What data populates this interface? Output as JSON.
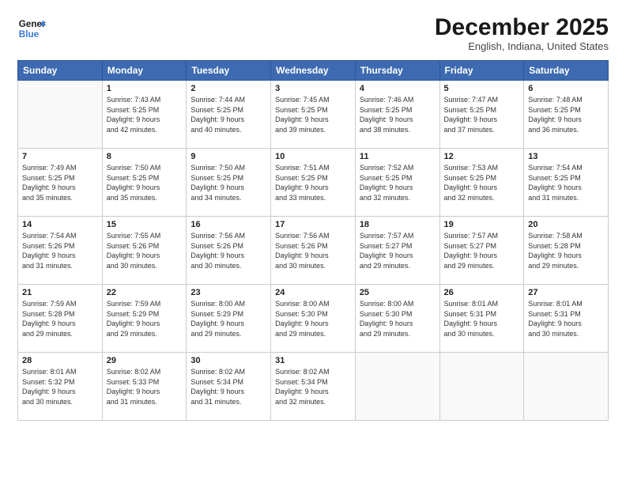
{
  "logo": {
    "line1": "General",
    "line2": "Blue"
  },
  "header": {
    "month": "December 2025",
    "location": "English, Indiana, United States"
  },
  "days_of_week": [
    "Sunday",
    "Monday",
    "Tuesday",
    "Wednesday",
    "Thursday",
    "Friday",
    "Saturday"
  ],
  "weeks": [
    [
      {
        "day": "",
        "info": ""
      },
      {
        "day": "1",
        "info": "Sunrise: 7:43 AM\nSunset: 5:25 PM\nDaylight: 9 hours\nand 42 minutes."
      },
      {
        "day": "2",
        "info": "Sunrise: 7:44 AM\nSunset: 5:25 PM\nDaylight: 9 hours\nand 40 minutes."
      },
      {
        "day": "3",
        "info": "Sunrise: 7:45 AM\nSunset: 5:25 PM\nDaylight: 9 hours\nand 39 minutes."
      },
      {
        "day": "4",
        "info": "Sunrise: 7:46 AM\nSunset: 5:25 PM\nDaylight: 9 hours\nand 38 minutes."
      },
      {
        "day": "5",
        "info": "Sunrise: 7:47 AM\nSunset: 5:25 PM\nDaylight: 9 hours\nand 37 minutes."
      },
      {
        "day": "6",
        "info": "Sunrise: 7:48 AM\nSunset: 5:25 PM\nDaylight: 9 hours\nand 36 minutes."
      }
    ],
    [
      {
        "day": "7",
        "info": "Sunrise: 7:49 AM\nSunset: 5:25 PM\nDaylight: 9 hours\nand 35 minutes."
      },
      {
        "day": "8",
        "info": "Sunrise: 7:50 AM\nSunset: 5:25 PM\nDaylight: 9 hours\nand 35 minutes."
      },
      {
        "day": "9",
        "info": "Sunrise: 7:50 AM\nSunset: 5:25 PM\nDaylight: 9 hours\nand 34 minutes."
      },
      {
        "day": "10",
        "info": "Sunrise: 7:51 AM\nSunset: 5:25 PM\nDaylight: 9 hours\nand 33 minutes."
      },
      {
        "day": "11",
        "info": "Sunrise: 7:52 AM\nSunset: 5:25 PM\nDaylight: 9 hours\nand 32 minutes."
      },
      {
        "day": "12",
        "info": "Sunrise: 7:53 AM\nSunset: 5:25 PM\nDaylight: 9 hours\nand 32 minutes."
      },
      {
        "day": "13",
        "info": "Sunrise: 7:54 AM\nSunset: 5:25 PM\nDaylight: 9 hours\nand 31 minutes."
      }
    ],
    [
      {
        "day": "14",
        "info": "Sunrise: 7:54 AM\nSunset: 5:26 PM\nDaylight: 9 hours\nand 31 minutes."
      },
      {
        "day": "15",
        "info": "Sunrise: 7:55 AM\nSunset: 5:26 PM\nDaylight: 9 hours\nand 30 minutes."
      },
      {
        "day": "16",
        "info": "Sunrise: 7:56 AM\nSunset: 5:26 PM\nDaylight: 9 hours\nand 30 minutes."
      },
      {
        "day": "17",
        "info": "Sunrise: 7:56 AM\nSunset: 5:26 PM\nDaylight: 9 hours\nand 30 minutes."
      },
      {
        "day": "18",
        "info": "Sunrise: 7:57 AM\nSunset: 5:27 PM\nDaylight: 9 hours\nand 29 minutes."
      },
      {
        "day": "19",
        "info": "Sunrise: 7:57 AM\nSunset: 5:27 PM\nDaylight: 9 hours\nand 29 minutes."
      },
      {
        "day": "20",
        "info": "Sunrise: 7:58 AM\nSunset: 5:28 PM\nDaylight: 9 hours\nand 29 minutes."
      }
    ],
    [
      {
        "day": "21",
        "info": "Sunrise: 7:59 AM\nSunset: 5:28 PM\nDaylight: 9 hours\nand 29 minutes."
      },
      {
        "day": "22",
        "info": "Sunrise: 7:59 AM\nSunset: 5:29 PM\nDaylight: 9 hours\nand 29 minutes."
      },
      {
        "day": "23",
        "info": "Sunrise: 8:00 AM\nSunset: 5:29 PM\nDaylight: 9 hours\nand 29 minutes."
      },
      {
        "day": "24",
        "info": "Sunrise: 8:00 AM\nSunset: 5:30 PM\nDaylight: 9 hours\nand 29 minutes."
      },
      {
        "day": "25",
        "info": "Sunrise: 8:00 AM\nSunset: 5:30 PM\nDaylight: 9 hours\nand 29 minutes."
      },
      {
        "day": "26",
        "info": "Sunrise: 8:01 AM\nSunset: 5:31 PM\nDaylight: 9 hours\nand 30 minutes."
      },
      {
        "day": "27",
        "info": "Sunrise: 8:01 AM\nSunset: 5:31 PM\nDaylight: 9 hours\nand 30 minutes."
      }
    ],
    [
      {
        "day": "28",
        "info": "Sunrise: 8:01 AM\nSunset: 5:32 PM\nDaylight: 9 hours\nand 30 minutes."
      },
      {
        "day": "29",
        "info": "Sunrise: 8:02 AM\nSunset: 5:33 PM\nDaylight: 9 hours\nand 31 minutes."
      },
      {
        "day": "30",
        "info": "Sunrise: 8:02 AM\nSunset: 5:34 PM\nDaylight: 9 hours\nand 31 minutes."
      },
      {
        "day": "31",
        "info": "Sunrise: 8:02 AM\nSunset: 5:34 PM\nDaylight: 9 hours\nand 32 minutes."
      },
      {
        "day": "",
        "info": ""
      },
      {
        "day": "",
        "info": ""
      },
      {
        "day": "",
        "info": ""
      }
    ]
  ]
}
